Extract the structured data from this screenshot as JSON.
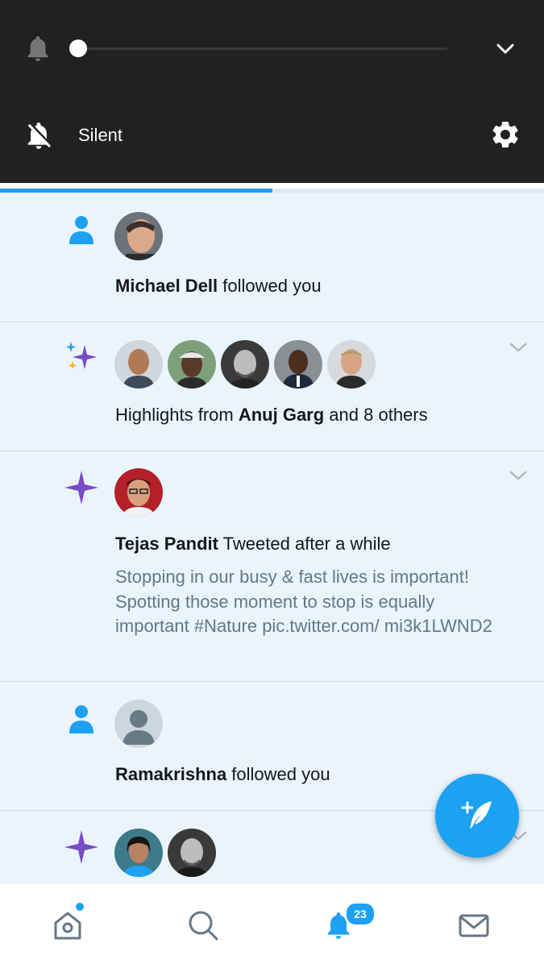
{
  "volume_panel": {
    "level": 0.0,
    "mode_label": "Silent",
    "icons": {
      "ring": "bell-icon",
      "expand": "chevron-down-icon",
      "mode": "bell-off-icon",
      "settings": "gear-icon"
    }
  },
  "loading_progress": 0.5,
  "notifications": [
    {
      "type": "follow",
      "icon": "person-icon",
      "name": "Michael Dell",
      "action": " followed you"
    },
    {
      "type": "highlights",
      "icon": "sparkle-icon",
      "prefix": "Highlights from ",
      "name": "Anuj Garg",
      "suffix": " and 8 others"
    },
    {
      "type": "tweet",
      "icon": "sparkle-icon",
      "name": "Tejas Pandit",
      "action": " Tweeted after a while",
      "body": "Stopping in our busy & fast lives is important! Spotting those moment to stop is equally important #Nature pic.twitter.com/ mi3k1LWND2"
    },
    {
      "type": "follow",
      "icon": "person-icon",
      "name": "Ramakrishna",
      "action": " followed you"
    },
    {
      "type": "highlights",
      "icon": "sparkle-icon"
    }
  ],
  "compose_button": {
    "icon": "compose-feather-icon"
  },
  "bottom_nav": {
    "items": [
      "home-icon",
      "search-icon",
      "notifications-bell-icon",
      "mail-icon"
    ],
    "notification_badge": "23"
  },
  "colors": {
    "accent": "#1da1f2",
    "sparkle": "#794bc4",
    "panel": "#212121",
    "feed_bg": "#e9f4fd"
  }
}
